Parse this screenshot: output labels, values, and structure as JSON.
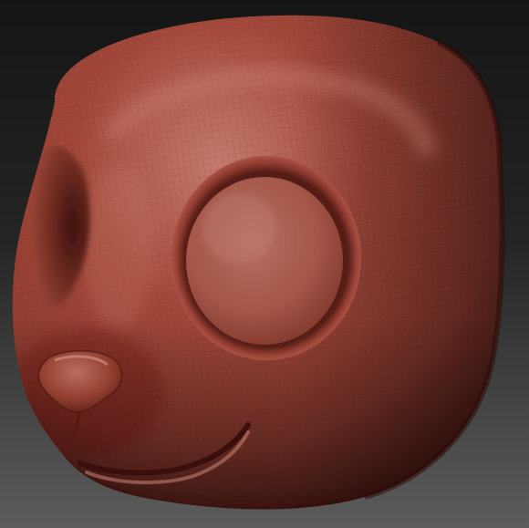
{
  "scene": {
    "subject": "sculpt-head-mesh",
    "colors": {
      "background_top": "#151515",
      "background_bottom": "#5c5c5c",
      "clay_highlight": "#c47b6d",
      "clay_base": "#a2483a",
      "clay_mid": "#8d3b2f",
      "clay_shadow": "#4b1712",
      "clay_dark": "#2b0a07",
      "wireframe": "#5a1e17"
    }
  }
}
